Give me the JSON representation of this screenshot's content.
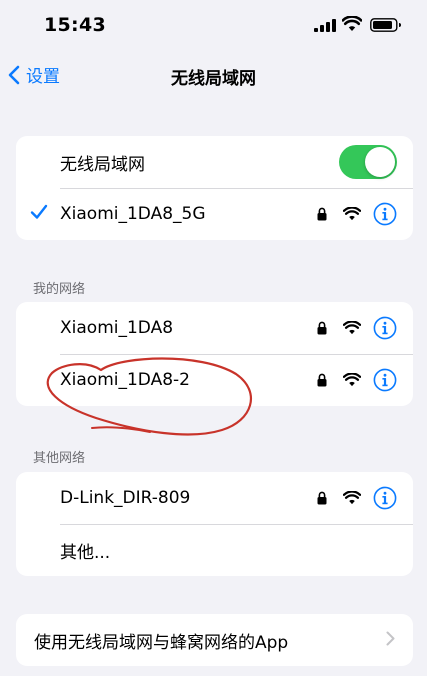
{
  "status_bar": {
    "time": "15:43"
  },
  "nav": {
    "back_label": "设置",
    "title": "无线局域网"
  },
  "wifi_toggle": {
    "label": "无线局域网",
    "on": true
  },
  "current_network": {
    "name": "Xiaomi_1DA8_5G",
    "secured": true,
    "connected": true
  },
  "my_networks": {
    "header": "我的网络",
    "items": [
      {
        "name": "Xiaomi_1DA8",
        "secured": true
      },
      {
        "name": "Xiaomi_1DA8-2",
        "secured": true
      }
    ]
  },
  "other_networks": {
    "header": "其他网络",
    "items": [
      {
        "name": "D-Link_DIR-809",
        "secured": true
      }
    ],
    "other_label": "其他..."
  },
  "apps_row": {
    "label": "使用无线局域网与蜂窝网络的App"
  },
  "colors": {
    "accent": "#0a7aff",
    "toggle_on": "#34c759",
    "annotation": "#c8332a",
    "background": "#f2f2f7"
  }
}
